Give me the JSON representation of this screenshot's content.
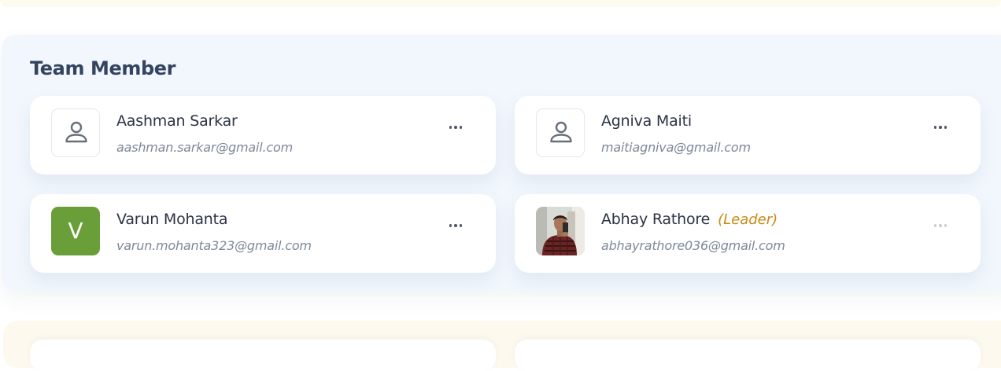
{
  "section": {
    "title": "Team Member"
  },
  "members": [
    {
      "name": "Aashman Sarkar",
      "email": "aashman.sarkar@gmail.com",
      "avatar": "user-icon",
      "role": ""
    },
    {
      "name": "Agniva Maiti",
      "email": "maitiagniva@gmail.com",
      "avatar": "user-icon",
      "role": ""
    },
    {
      "name": "Varun Mohanta",
      "email": "varun.mohanta323@gmail.com",
      "avatar": "initial",
      "initial": "V",
      "avatar_color": "#6a9e38",
      "role": ""
    },
    {
      "name": "Abhay Rathore",
      "email": "abhayrathore036@gmail.com",
      "avatar": "photo",
      "role": "(Leader)"
    }
  ],
  "colors": {
    "panel_background": "#f2f7fd",
    "title": "#34435f",
    "leader_label": "#c98a14",
    "email": "#7e889b"
  },
  "icons": {
    "menu": "more-horizontal-icon",
    "placeholder_avatar": "user-icon"
  }
}
